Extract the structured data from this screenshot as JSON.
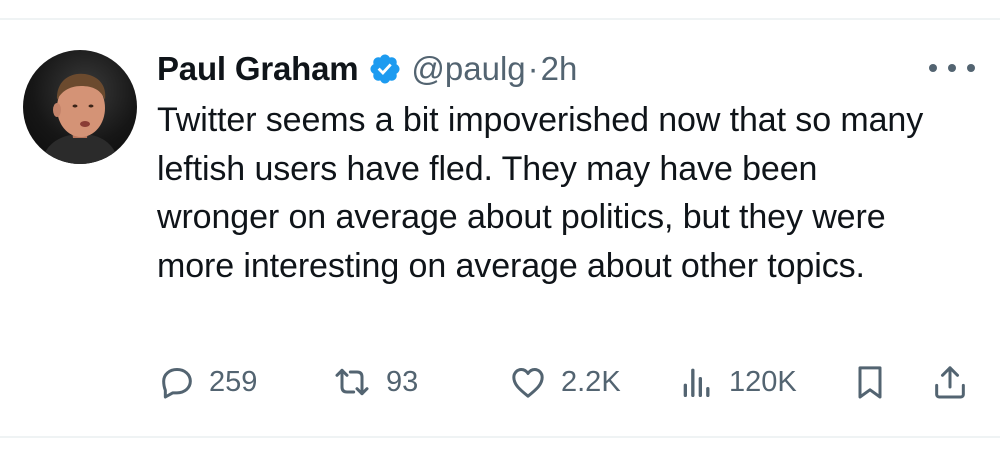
{
  "tweet": {
    "author": {
      "name": "Paul Graham",
      "handle": "@paulg",
      "separator": "·",
      "time": "2h",
      "verified": true
    },
    "text": "Twitter seems a bit impoverished now that so many leftish users have fled. They may have been wronger on average about politics, but they were more interesting on average about other topics.",
    "metrics": {
      "replies": "259",
      "reposts": "93",
      "likes": "2.2K",
      "views": "120K"
    }
  },
  "icons": {
    "verified": "verified-badge-icon",
    "more": "more-options-icon",
    "reply": "reply-icon",
    "repost": "repost-icon",
    "like": "heart-icon",
    "views": "bar-chart-icon",
    "bookmark": "bookmark-icon",
    "share": "share-icon"
  },
  "colors": {
    "text": "#0f1419",
    "secondary": "#536471",
    "verified": "#1d9bf0",
    "divider": "#eff3f4"
  }
}
